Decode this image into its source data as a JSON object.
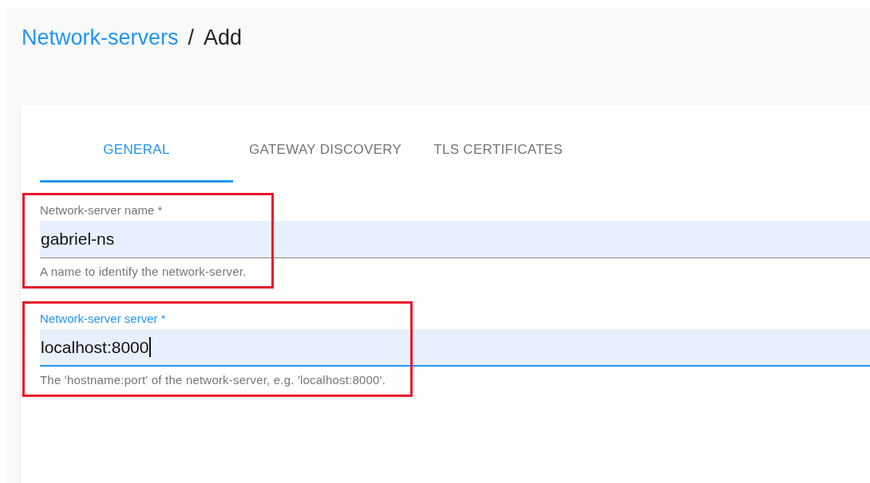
{
  "breadcrumb": {
    "parent": "Network-servers",
    "separator": "/",
    "current": "Add"
  },
  "tabs": [
    {
      "label": "GENERAL",
      "selected": true
    },
    {
      "label": "GATEWAY DISCOVERY",
      "selected": false
    },
    {
      "label": "TLS CERTIFICATES",
      "selected": false
    }
  ],
  "fields": [
    {
      "label": "Network-server name *",
      "value": "gabriel-ns",
      "helper": "A name to identify the network-server.",
      "focused": false,
      "highlighted": true
    },
    {
      "label": "Network-server server *",
      "value": "localhost:8000",
      "helper": "The 'hostname:port' of the network-server, e.g. 'localhost:8000'.",
      "focused": true,
      "highlighted": true
    }
  ]
}
